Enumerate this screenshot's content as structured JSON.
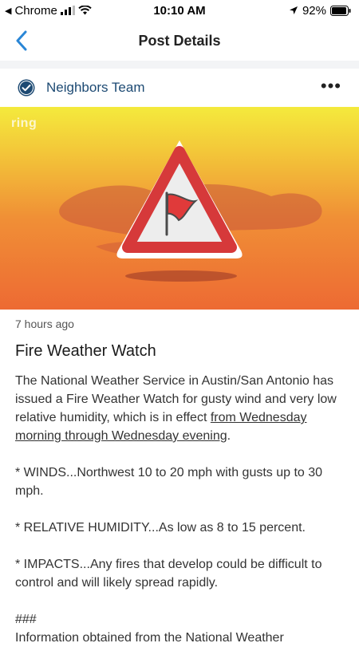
{
  "status_bar": {
    "back_app": "Chrome",
    "time": "10:10 AM",
    "battery": "92%"
  },
  "nav": {
    "title": "Post Details"
  },
  "post": {
    "author": "Neighbors Team",
    "hero_watermark": "ring",
    "timestamp": "7 hours ago",
    "title": "Fire Weather Watch",
    "paragraph1_text": "The National Weather Service in Austin/San Antonio has issued a Fire Weather Watch for gusty wind and very low relative humidity, which is in effect ",
    "paragraph1_link": "from Wednesday morning through Wednesday evening",
    "paragraph1_end": ".",
    "winds": "* WINDS...Northwest 10 to 20 mph with gusts up to 30 mph.",
    "humidity": "* RELATIVE HUMIDITY...As low as 8 to 15 percent.",
    "impacts": "* IMPACTS...Any fires that develop could be difficult to control and will likely spread rapidly.",
    "separator": "###",
    "info": "Information obtained from the National Weather"
  },
  "colors": {
    "accent": "#2a86d6",
    "author": "#1d4a73",
    "hero_top": "#f4ea3c",
    "hero_bottom": "#ed6a33",
    "warning_red": "#d6393a"
  }
}
